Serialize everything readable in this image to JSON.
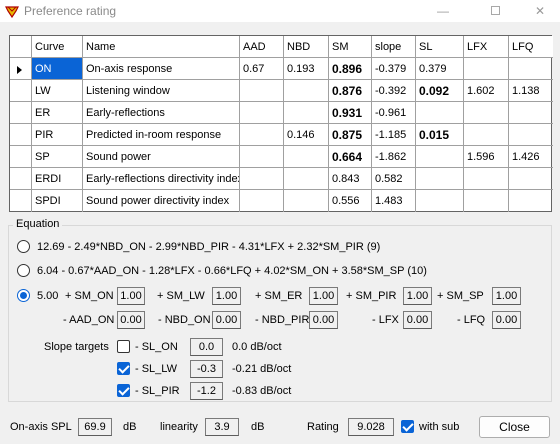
{
  "window": {
    "title": "Preference rating"
  },
  "grid": {
    "columns": [
      "Curve",
      "Name",
      "AAD",
      "NBD",
      "SM",
      "slope",
      "SL",
      "LFX",
      "LFQ"
    ],
    "rows": [
      {
        "curve": "ON",
        "name": "On-axis response",
        "aad": "0.67",
        "nbd": "0.193",
        "sm": "0.896",
        "slope": "-0.379",
        "sl": "0.379",
        "lfx": "",
        "lfq": ""
      },
      {
        "curve": "LW",
        "name": "Listening window",
        "aad": "",
        "nbd": "",
        "sm": "0.876",
        "slope": "-0.392",
        "sl": "0.092",
        "lfx": "1.602",
        "lfq": "1.138"
      },
      {
        "curve": "ER",
        "name": "Early-reflections",
        "aad": "",
        "nbd": "",
        "sm": "0.931",
        "slope": "-0.961",
        "sl": "",
        "lfx": "",
        "lfq": ""
      },
      {
        "curve": "PIR",
        "name": "Predicted in-room response",
        "aad": "",
        "nbd": "0.146",
        "sm": "0.875",
        "slope": "-1.185",
        "sl": "0.015",
        "lfx": "",
        "lfq": ""
      },
      {
        "curve": "SP",
        "name": "Sound power",
        "aad": "",
        "nbd": "",
        "sm": "0.664",
        "slope": "-1.862",
        "sl": "",
        "lfx": "1.596",
        "lfq": "1.426"
      },
      {
        "curve": "ERDI",
        "name": "Early-reflections directivity index",
        "aad": "",
        "nbd": "",
        "sm": "0.843",
        "slope": "0.582",
        "sl": "",
        "lfx": "",
        "lfq": ""
      },
      {
        "curve": "SPDI",
        "name": "Sound power directivity index",
        "aad": "",
        "nbd": "",
        "sm": "0.556",
        "slope": "1.483",
        "sl": "",
        "lfx": "",
        "lfq": ""
      }
    ]
  },
  "equation": {
    "group_label": "Equation",
    "option1": "12.69 - 2.49*NBD_ON - 2.99*NBD_PIR - 4.31*LFX + 2.32*SM_PIR (9)",
    "option2": "6.04 - 0.67*AAD_ON - 1.28*LFX - 0.66*LFQ + 4.02*SM_ON + 3.58*SM_SP (10)",
    "custom": {
      "const": "5.00",
      "terms_pos": [
        {
          "label": "+ SM_ON",
          "value": "1.00"
        },
        {
          "label": "+ SM_LW",
          "value": "1.00"
        },
        {
          "label": "+ SM_ER",
          "value": "1.00"
        },
        {
          "label": "+ SM_PIR",
          "value": "1.00"
        },
        {
          "label": "+ SM_SP",
          "value": "1.00"
        }
      ],
      "terms_neg": [
        {
          "label": "- AAD_ON",
          "value": "0.00"
        },
        {
          "label": "- NBD_ON",
          "value": "0.00"
        },
        {
          "label": "- NBD_PIR",
          "value": "0.00"
        },
        {
          "label": "- LFX",
          "value": "0.00"
        },
        {
          "label": "- LFQ",
          "value": "0.00"
        }
      ]
    },
    "slope_targets_label": "Slope targets",
    "slope_targets": [
      {
        "label": "- SL_ON",
        "value": "0.0",
        "result": "0.0 dB/oct",
        "checked": false
      },
      {
        "label": "- SL_LW",
        "value": "-0.3",
        "result": "-0.21 dB/oct",
        "checked": true
      },
      {
        "label": "- SL_PIR",
        "value": "-1.2",
        "result": "-0.83 dB/oct",
        "checked": true
      }
    ]
  },
  "footer": {
    "onaxis_label": "On-axis SPL",
    "onaxis_value": "69.9",
    "onaxis_unit": "dB",
    "linearity_label": "linearity",
    "linearity_value": "3.9",
    "linearity_unit": "dB",
    "rating_label": "Rating",
    "rating_value": "9.028",
    "with_sub_label": "with sub",
    "with_sub_checked": true,
    "close_label": "Close"
  },
  "colors": {
    "accent": "#0a64d6",
    "selected_cell": "#0a64d6"
  }
}
